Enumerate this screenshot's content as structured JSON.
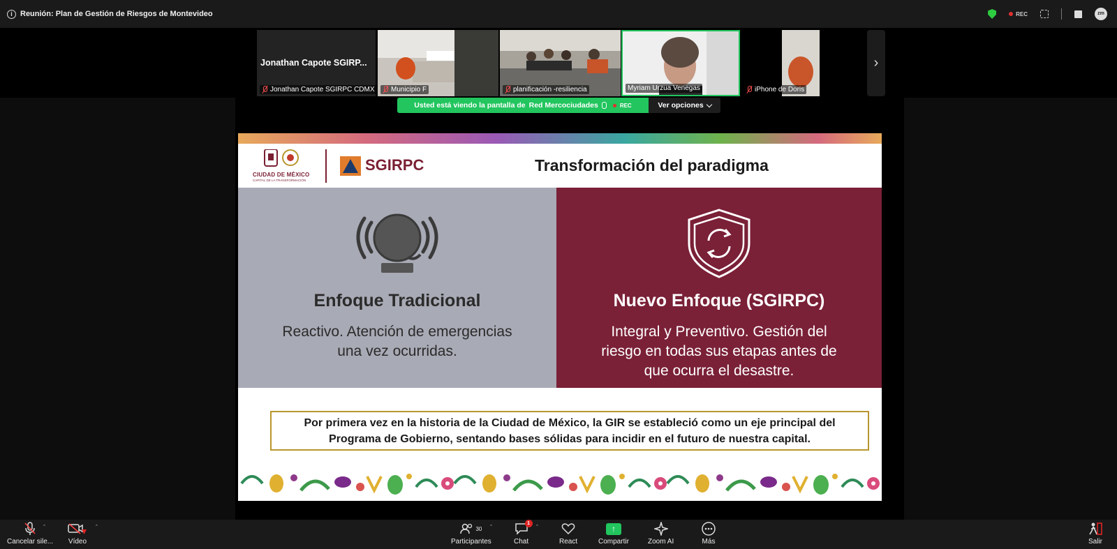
{
  "window": {
    "meeting_title": "Reunión: Plan de Gestión de Riesgos de Montevideo",
    "rec_label": "REC",
    "user_avatar_text": "zm"
  },
  "gallery": {
    "tiles": [
      {
        "big_name": "Jonathan Capote SGIRP...",
        "name": "Jonathan Capote SGIRPC CDMX",
        "muted": true,
        "video": false
      },
      {
        "name": "Municipio F",
        "muted": true,
        "video": true
      },
      {
        "name": "planificación -resiliencia",
        "muted": true,
        "video": true
      },
      {
        "name": "Myriam Urzua Venegas",
        "muted": false,
        "video": true,
        "active": true
      },
      {
        "name": "iPhone de Doris",
        "muted": true,
        "video": true
      }
    ],
    "next_icon": "chevron-right-icon"
  },
  "share_banner": {
    "viewing_text": "Usted está viendo la pantalla de",
    "presenter": "Red Mercociudades",
    "rec_label": "REC",
    "view_options_label": "Ver opciones"
  },
  "slide": {
    "cdmx_name": "CIUDAD DE MÉXICO",
    "cdmx_tagline": "CAPITAL DE LA TRANSFORMACIÓN",
    "agency": "SGIRPC",
    "title": "Transformación del paradigma",
    "left": {
      "icon": "alarm-bell-icon",
      "heading": "Enfoque Tradicional",
      "body_line1": "Reactivo. Atención de emergencias",
      "body_line2": "una vez ocurridas."
    },
    "right": {
      "icon": "shield-cycle-icon",
      "heading": "Nuevo Enfoque (SGIRPC)",
      "body_line1": "Integral y Preventivo. Gestión del",
      "body_line2": "riesgo en todas sus etapas antes de",
      "body_line3": "que ocurra el desastre."
    },
    "note_line1": "Por primera vez en la historia de la Ciudad de México, la GIR se estableció como un eje principal del",
    "note_line2": "Programa de Gobierno, sentando bases sólidas para incidir en el futuro de nuestra capital.",
    "colors": {
      "maroon": "#7a2037",
      "gray_panel": "#a8aab5",
      "gold_border": "#b8962e"
    }
  },
  "toolbar": {
    "mute": {
      "label": "Cancelar sile...",
      "icon": "microphone-icon"
    },
    "video": {
      "label": "Vídeo",
      "icon": "video-camera-icon"
    },
    "participants": {
      "label": "Participantes",
      "count": "30",
      "icon": "people-icon"
    },
    "chat": {
      "label": "Chat",
      "badge": "1",
      "icon": "chat-bubble-icon"
    },
    "react": {
      "label": "React",
      "icon": "heart-icon"
    },
    "share": {
      "label": "Compartir",
      "icon": "share-screen-icon"
    },
    "zoom_ai": {
      "label": "Zoom AI",
      "icon": "sparkle-icon"
    },
    "more": {
      "label": "Más",
      "icon": "more-dots-icon"
    },
    "exit": {
      "label": "Salir",
      "icon": "exit-icon"
    }
  }
}
